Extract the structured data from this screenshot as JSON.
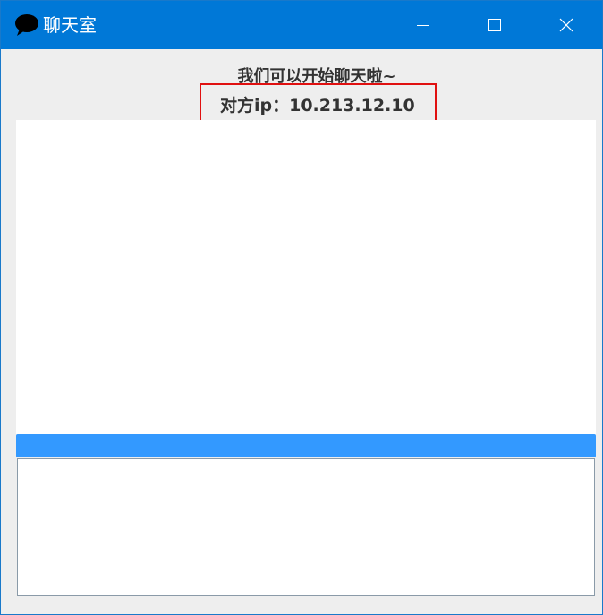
{
  "window": {
    "title": "聊天室",
    "icon": "speech-bubble-icon",
    "titlebar_color": "#0078d7",
    "controls": {
      "minimize_icon": "minimize-icon",
      "maximize_icon": "maximize-icon",
      "close_icon": "close-icon"
    }
  },
  "header": {
    "greeting": "我们可以开始聊天啦~",
    "peer_ip_text": "对方ip：10.213.12.10"
  },
  "annotation": {
    "highlight_color": "#e01010"
  },
  "chat": {
    "messages": [],
    "send_bar_color": "#3399ff",
    "input_value": ""
  }
}
